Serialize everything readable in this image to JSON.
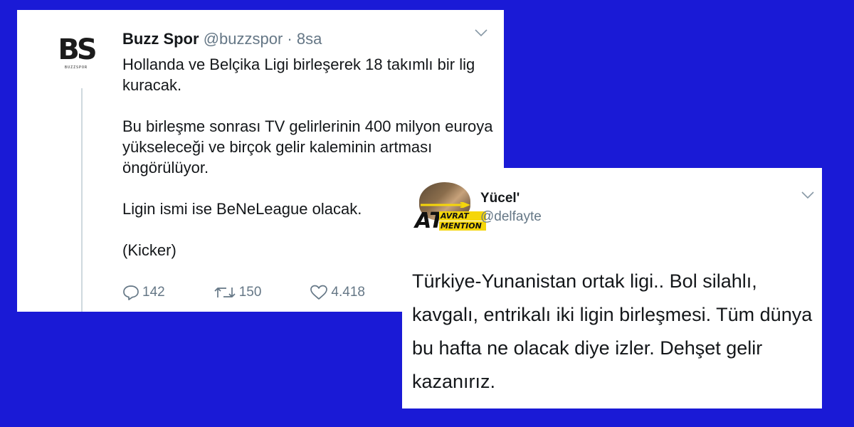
{
  "tweet1": {
    "avatar_text": "BS",
    "avatar_subtext": "BUZZSPOR",
    "name": "Buzz Spor",
    "handle": "@buzzspor",
    "separator": "·",
    "time": "8sa",
    "paragraphs": [
      "Hollanda ve Belçika Ligi birleşerek 18 takımlı bir lig kuracak.",
      "Bu birleşme sonrası TV gelirlerinin 400 milyon euroya yükseleceği ve birçok gelir kaleminin artması öngörülüyor.",
      "Ligin ismi ise BeNeLeague olacak.",
      "(Kicker)"
    ],
    "actions": {
      "replies": "142",
      "retweets": "150",
      "likes": "4.418"
    }
  },
  "tweet2": {
    "avatar_badge_big": "AT",
    "avatar_badge_line1": "AVRAT",
    "avatar_badge_line2": "MENTION",
    "name": "Yücel'",
    "handle": "@delfayte",
    "text": "Türkiye-Yunanistan ortak ligi.. Bol silahlı, kavgalı, entrikalı iki ligin birleşmesi. Tüm dünya bu hafta ne olacak diye izler. Dehşet gelir kazanırız."
  },
  "colors": {
    "background": "#1a1ad6",
    "card": "#ffffff",
    "text": "#14171a",
    "muted": "#657786",
    "badge_yellow": "#f5d60a"
  }
}
